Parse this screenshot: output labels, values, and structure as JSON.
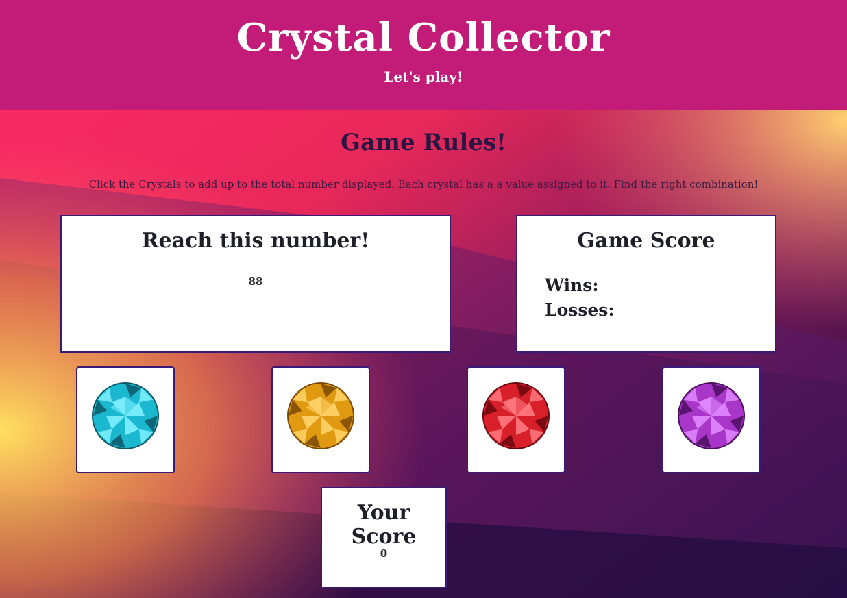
{
  "header": {
    "title": "Crystal Collector",
    "tagline": "Let's play!"
  },
  "rules": {
    "title": "Game Rules!",
    "text": "Click the Crystals to add up to the total number displayed. Each crystal has a a value assigned to it. Find the right combination!"
  },
  "target": {
    "title": "Reach this number!",
    "value": "88"
  },
  "game_score": {
    "title": "Game Score",
    "wins_label": "Wins:",
    "losses_label": "Losses:"
  },
  "crystals": [
    {
      "name": "blue-crystal",
      "color": "#1bb8d0",
      "dark": "#0a5868",
      "light": "#7ef0ff"
    },
    {
      "name": "yellow-crystal",
      "color": "#e09a12",
      "dark": "#7a4a04",
      "light": "#ffd46a"
    },
    {
      "name": "red-crystal",
      "color": "#d8202a",
      "dark": "#6a080e",
      "light": "#ff7a80"
    },
    {
      "name": "purple-crystal",
      "color": "#a836c8",
      "dark": "#4a0e5e",
      "light": "#e08aff"
    }
  ],
  "your_score": {
    "title": "Your Score",
    "value": "0"
  },
  "colors": {
    "header": "#c21b78",
    "border": "#3a1a78"
  }
}
